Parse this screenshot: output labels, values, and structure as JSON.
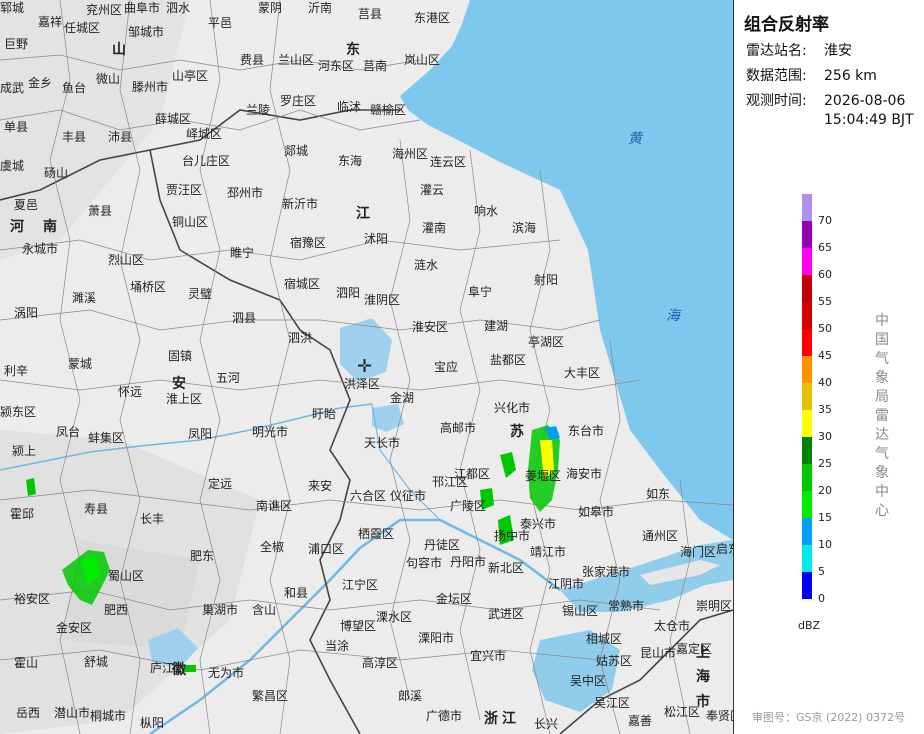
{
  "panel": {
    "title": "组合反射率",
    "station_label": "雷达站名:",
    "station_value": "淮安",
    "range_label": "数据范围:",
    "range_value": "256 km",
    "time_label": "观测时间:",
    "time_date": "2026-08-06",
    "time_clock": "15:04:49 BJT",
    "legend_values": [
      "70",
      "65",
      "60",
      "55",
      "50",
      "45",
      "40",
      "35",
      "30",
      "25",
      "20",
      "15",
      "10",
      "5",
      "0"
    ],
    "legend_colors": [
      "#ad90f0",
      "#9600b4",
      "#ff00f0",
      "#c00000",
      "#d60000",
      "#ff0000",
      "#ff9000",
      "#e7c000",
      "#ffff00",
      "#008000",
      "#00c800",
      "#00ec00",
      "#01a0f6",
      "#00ecec",
      "#0000f6"
    ],
    "unit": "dBZ",
    "agency": "中国气象局雷达气象中心",
    "approval": "审图号：GS京 (2022) 0372号"
  },
  "map": {
    "provinces": [
      "山",
      "东",
      "河",
      "南",
      "江",
      "安",
      "苏",
      "徽",
      "上",
      "海",
      "市",
      "浙",
      "江"
    ],
    "seas": [
      "黄",
      "海"
    ],
    "places": [
      "郓城",
      "兖州区",
      "曲阜市",
      "泗水",
      "蒙阴",
      "沂南",
      "莒县",
      "东港区",
      "巨野",
      "嘉祥",
      "任城区",
      "邹城市",
      "平邑",
      "费县",
      "兰山区",
      "河东区",
      "莒南",
      "岚山区",
      "成武",
      "金乡",
      "鱼台",
      "微山",
      "滕州市",
      "山亭区",
      "兰陵",
      "罗庄区",
      "临沭",
      "赣榆区",
      "单县",
      "丰县",
      "沛县",
      "薛城区",
      "峄城区",
      "郯城",
      "东海",
      "海州区",
      "连云区",
      "虞城",
      "砀山",
      "台儿庄区",
      "灌云",
      "贾汪区",
      "邳州市",
      "夏邑",
      "萧县",
      "铜山区",
      "新沂市",
      "沭阳",
      "灌南",
      "响水",
      "滨海",
      "永城市",
      "睢宁",
      "宿豫区",
      "涟水",
      "烈山区",
      "埇桥区",
      "灵璧",
      "宿城区",
      "泗阳",
      "淮阴区",
      "阜宁",
      "射阳",
      "濉溪",
      "涡阳",
      "泗县",
      "泗洪",
      "淮安区",
      "建湖",
      "亭湖区",
      "蒙城",
      "固镇",
      "盱眙",
      "宝应",
      "盐都区",
      "大丰区",
      "利辛",
      "怀远",
      "五河",
      "洪泽区",
      "金湖",
      "兴化市",
      "颍东区",
      "淮上区",
      "明光市",
      "天长市",
      "高邮市",
      "东台市",
      "凤台",
      "蚌集区",
      "凤阳",
      "颍上",
      "江都区",
      "姜堰区",
      "海安市",
      "定远",
      "来安",
      "六合区",
      "仪征市",
      "邗江区",
      "广陵区",
      "如皋市",
      "如东",
      "霍邱",
      "寿县",
      "长丰",
      "南谯区",
      "栖霞区",
      "扬中市",
      "泰兴市",
      "靖江市",
      "通州区",
      "肥东",
      "全椒",
      "浦口区",
      "句容市",
      "丹徒区",
      "丹阳市",
      "新北区",
      "张家港市",
      "启东市",
      "海门区",
      "蜀山区",
      "江宁区",
      "金坛区",
      "江阴市",
      "常熟市",
      "崇明区",
      "裕安区",
      "金安区",
      "肥西",
      "巢湖市",
      "含山",
      "和县",
      "溧水区",
      "溧阳市",
      "武进区",
      "锡山区",
      "太仓市",
      "博望区",
      "宜兴市",
      "相城区",
      "昆山市",
      "嘉定区",
      "霍山",
      "舒城",
      "庐江",
      "无为市",
      "当涂",
      "高淳区",
      "吴中区",
      "姑苏区",
      "吴江区",
      "岳西",
      "潜山市",
      "桐城市",
      "枞阳",
      "繁昌区",
      "郎溪",
      "广德市",
      "长兴",
      "嘉善",
      "松江区",
      "奉贤区"
    ]
  }
}
